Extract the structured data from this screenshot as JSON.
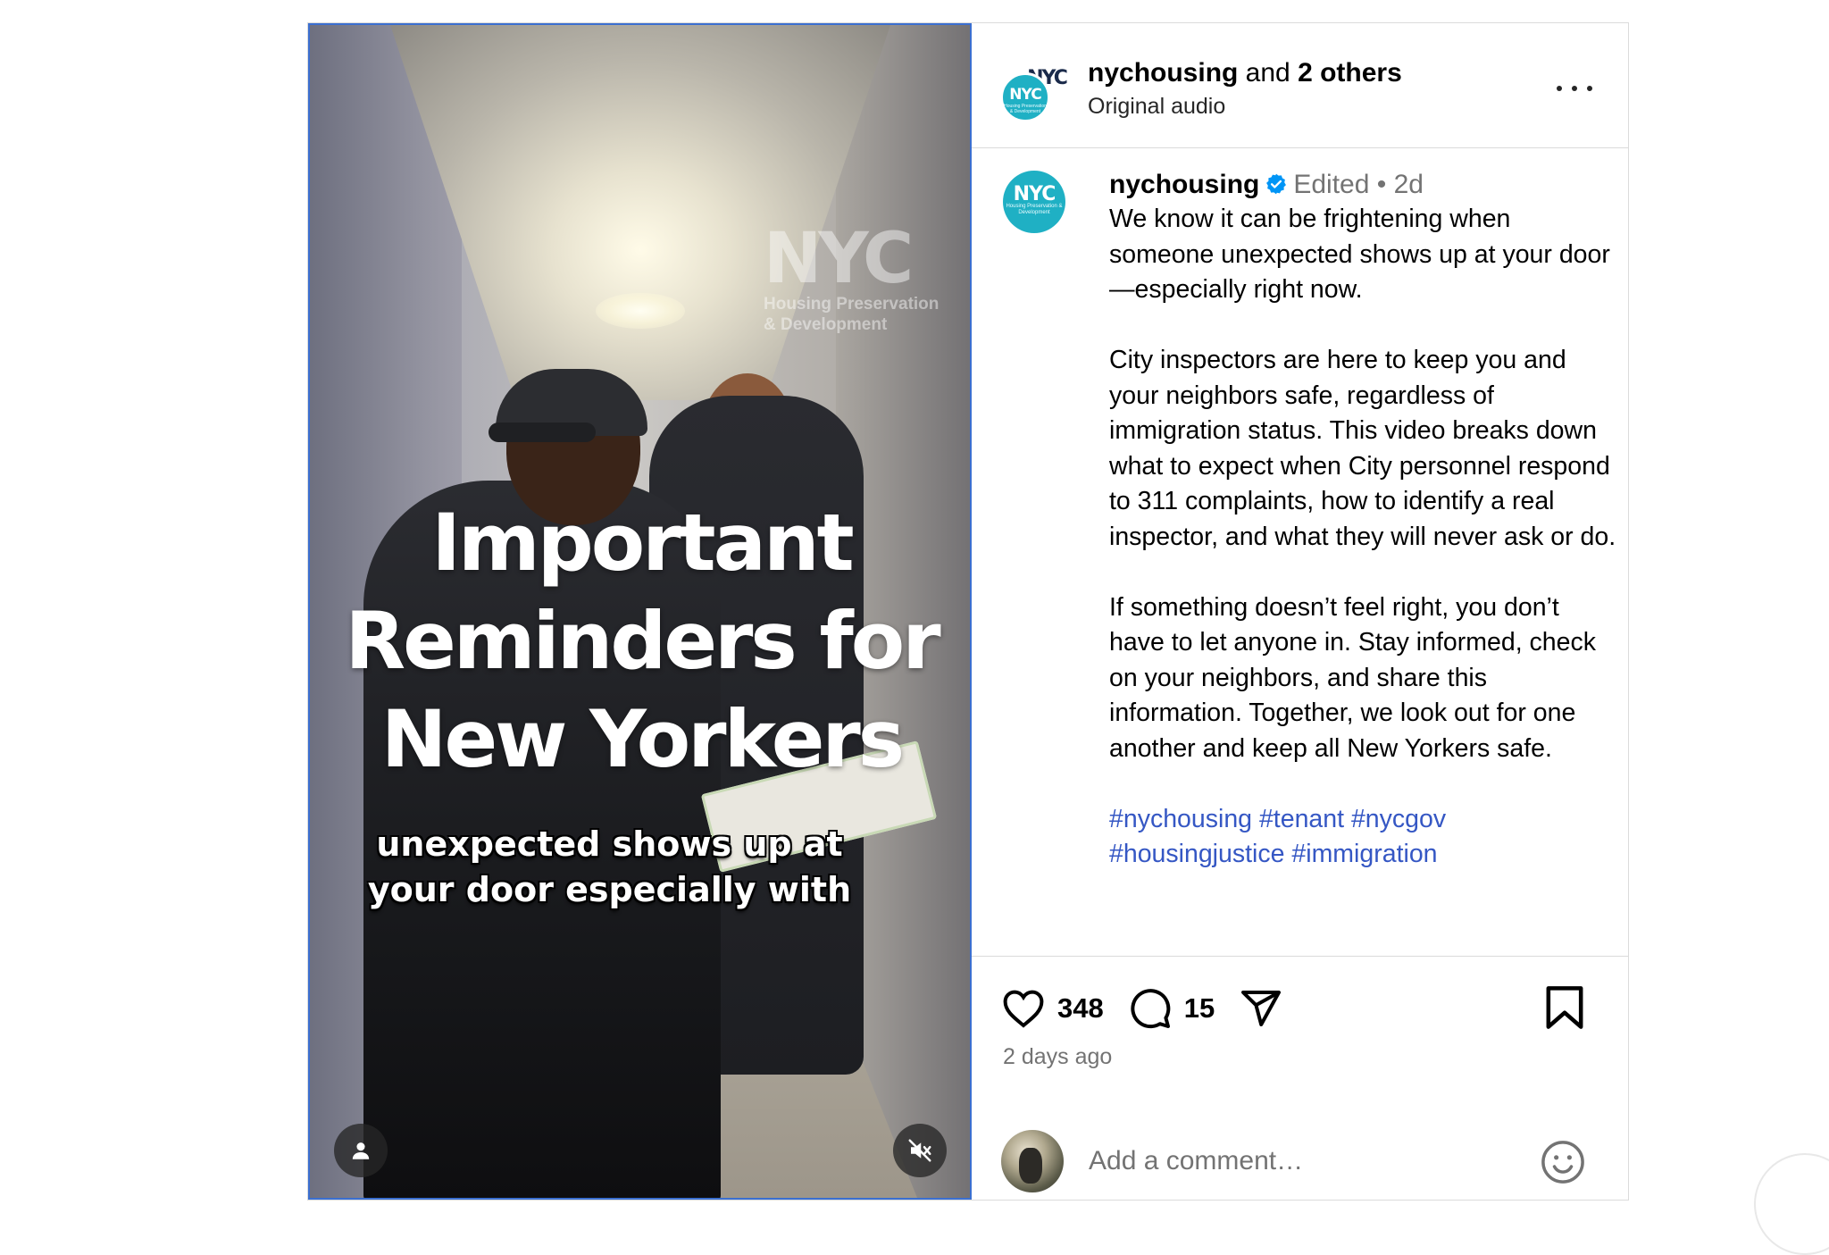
{
  "video": {
    "watermark_logo": "NYC",
    "watermark_line1": "Housing Preservation",
    "watermark_line2": "& Development",
    "headline_lines": [
      "Important",
      "Reminders for",
      "New Yorkers"
    ],
    "caption_lines": [
      "unexpected shows up at",
      "your door especially with"
    ]
  },
  "header": {
    "username": "nychousing",
    "and_text": " and ",
    "others": "2 others",
    "audio": "Original audio",
    "avatar_back_logo": "NYC",
    "avatar_front_logo": "NYC",
    "avatar_front_sub": "Housing Preservation & Development"
  },
  "post": {
    "username": "nychousing",
    "edited": "Edited",
    "dot": "•",
    "age": "2d",
    "avatar_logo": "NYC",
    "avatar_sub": "Housing Preservation & Development",
    "paragraphs": [
      "We know it can be frightening when someone unexpected shows up at your door—especially right now.",
      "City inspectors are here to keep you and your neighbors safe, regardless of immigration status. This video breaks down what to expect when City personnel respond to 311 complaints, how to identify a real inspector, and what they will never ask or do.",
      "If something doesn’t feel right, you don’t have to let anyone in. Stay informed, check on your neighbors, and share this information. Together, we look out for one another and keep all New Yorkers safe."
    ],
    "hashtags_line1": "#nychousing #tenant #nycgov",
    "hashtags_line2": "#housingjustice #immigration"
  },
  "actions": {
    "likes": "348",
    "comments": "15",
    "time_ago": "2 days ago",
    "comment_placeholder": "Add a comment…"
  },
  "colors": {
    "accent_link": "#3557c4",
    "verified": "#0095f6",
    "brand_teal": "#1fb0c4"
  },
  "icons": [
    "person-icon",
    "mute-icon",
    "more-icon",
    "verified-badge-icon",
    "heart-icon",
    "comment-icon",
    "share-icon",
    "bookmark-icon",
    "emoji-icon"
  ]
}
